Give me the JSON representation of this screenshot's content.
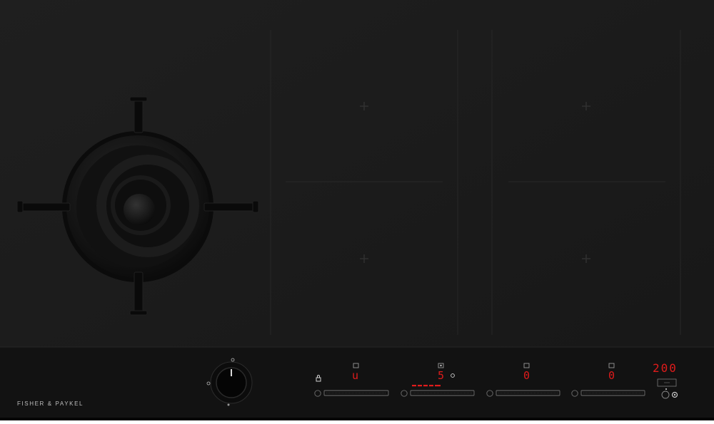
{
  "brand": {
    "name": "FISHER & PAYKEL"
  },
  "controls": {
    "gas_knob": {
      "name": "gas burner knob"
    },
    "zones": [
      {
        "display": "u"
      },
      {
        "display": "5"
      },
      {
        "display": "0"
      },
      {
        "display": "0"
      }
    ],
    "timer_display": "200"
  }
}
